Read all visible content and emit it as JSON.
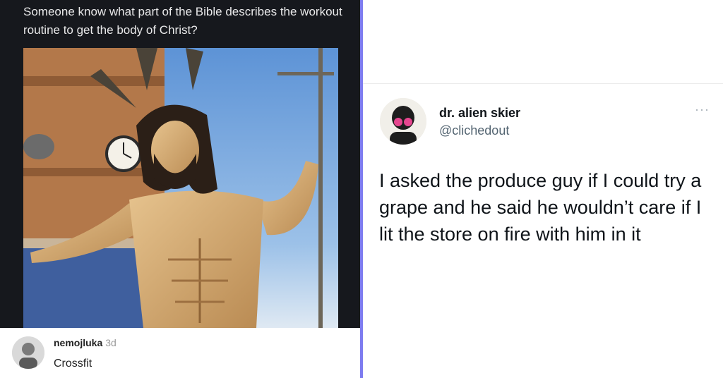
{
  "left_post": {
    "title": "Someone know what part of the Bible describes the workout routine to get the body of Christ?",
    "comment": {
      "username": "nemojluka",
      "time": "3d",
      "text": "Crossfit"
    }
  },
  "tweet": {
    "display_name": "dr. alien skier",
    "handle": "@clichedout",
    "more_label": "···",
    "text": "I asked the produce guy if I could try a grape and he said he wouldn’t care if I lit the store on fire with him in it"
  },
  "colors": {
    "divider": "#7e7cf0",
    "dark_bg": "#16181d",
    "tweet_text": "#0f1419",
    "handle": "#536471"
  }
}
